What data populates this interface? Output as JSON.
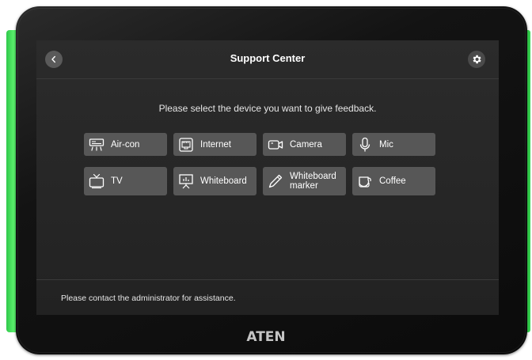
{
  "header": {
    "title": "Support Center"
  },
  "prompt": "Please select the device you want to give feedback.",
  "devices": [
    {
      "label": "Air-con",
      "icon": "air-conditioner-icon"
    },
    {
      "label": "Internet",
      "icon": "network-port-icon"
    },
    {
      "label": "Camera",
      "icon": "camera-icon"
    },
    {
      "label": "Mic",
      "icon": "microphone-icon"
    },
    {
      "label": "TV",
      "icon": "tv-icon"
    },
    {
      "label": "Whiteboard",
      "icon": "whiteboard-icon"
    },
    {
      "label": "Whiteboard\nmarker",
      "icon": "marker-pen-icon"
    },
    {
      "label": "Coffee",
      "icon": "coffee-pot-icon"
    }
  ],
  "footer": {
    "text": "Please contact the administrator for assistance."
  },
  "brand": {
    "logo": "ATEN"
  },
  "colors": {
    "accent_led": "#3bdc55",
    "button_bg": "#575757",
    "screen_bg": "#262626"
  }
}
